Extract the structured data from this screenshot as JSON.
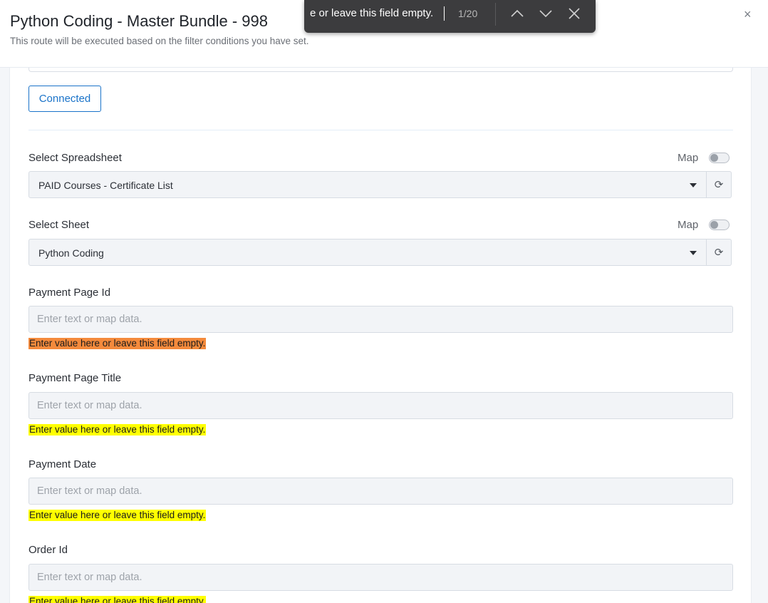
{
  "header": {
    "title": "Python Coding - Master Bundle - 998",
    "subtitle": "This route will be executed based on the filter conditions you have set.",
    "close_icon": "×"
  },
  "findbar": {
    "query": "e or leave this field empty.",
    "count": "1/20"
  },
  "connection": {
    "button_label": "Connected"
  },
  "spreadsheet": {
    "label": "Select Spreadsheet",
    "map_label": "Map",
    "value": "PAID Courses - Certificate List",
    "refresh_icon": "⟳"
  },
  "sheet": {
    "label": "Select Sheet",
    "map_label": "Map",
    "value": "Python Coding",
    "refresh_icon": "⟳"
  },
  "fields": [
    {
      "label": "Payment Page Id",
      "placeholder": "Enter text or map data.",
      "hint": "Enter value here or leave this field empty."
    },
    {
      "label": "Payment Page Title",
      "placeholder": "Enter text or map data.",
      "hint": "Enter value here or leave this field empty."
    },
    {
      "label": "Payment Date",
      "placeholder": "Enter text or map data.",
      "hint": "Enter value here or leave this field empty."
    },
    {
      "label": "Order Id",
      "placeholder": "Enter text or map data.",
      "hint": "Enter value here or leave this field empty."
    }
  ],
  "colors": {
    "accent": "#1a73c9",
    "highlight_current": "#f48a3c",
    "highlight_match": "#ffff00"
  }
}
